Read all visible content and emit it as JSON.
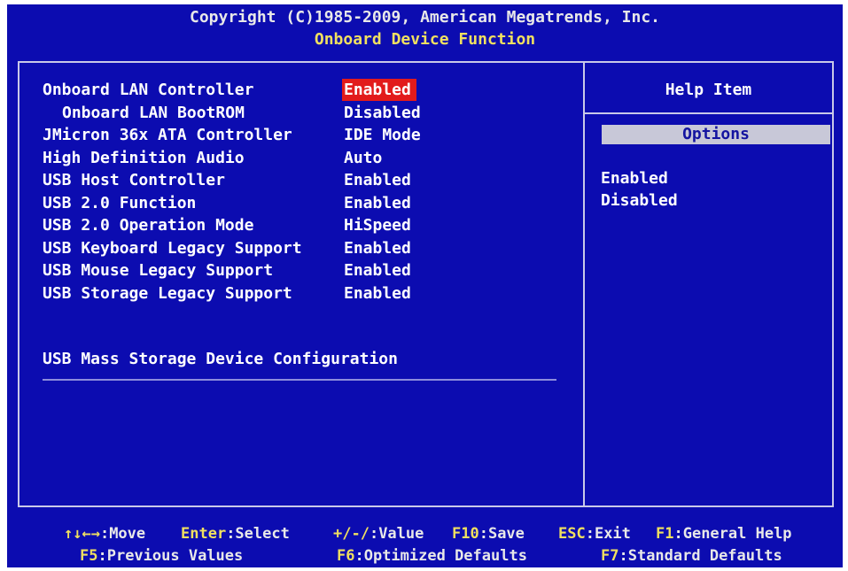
{
  "header": {
    "copyright": "Copyright (C)1985-2009, American Megatrends, Inc.",
    "page_title": "Onboard Device Function"
  },
  "settings": [
    {
      "label": "Onboard LAN Controller",
      "value": "Enabled",
      "indent": false,
      "selected": true
    },
    {
      "label": "Onboard LAN BootROM",
      "value": "Disabled",
      "indent": true,
      "selected": false
    },
    {
      "label": "JMicron 36x ATA Controller",
      "value": "IDE Mode",
      "indent": false,
      "selected": false
    },
    {
      "label": "High Definition Audio",
      "value": "Auto",
      "indent": false,
      "selected": false
    },
    {
      "label": "USB Host Controller",
      "value": "Enabled",
      "indent": false,
      "selected": false
    },
    {
      "label": "USB 2.0 Function",
      "value": "Enabled",
      "indent": false,
      "selected": false
    },
    {
      "label": "USB 2.0 Operation Mode",
      "value": "HiSpeed",
      "indent": false,
      "selected": false
    },
    {
      "label": "USB Keyboard Legacy Support",
      "value": "Enabled",
      "indent": false,
      "selected": false
    },
    {
      "label": "USB Mouse Legacy Support",
      "value": "Enabled",
      "indent": false,
      "selected": false
    },
    {
      "label": "USB Storage Legacy Support",
      "value": "Enabled",
      "indent": false,
      "selected": false
    }
  ],
  "submenu": {
    "label": "USB Mass Storage Device Configuration"
  },
  "help": {
    "title": "Help Item",
    "options_label": "Options",
    "options": [
      "Enabled",
      "Disabled"
    ]
  },
  "footer": {
    "row1": [
      {
        "key": "↑↓←→",
        "action": ":Move"
      },
      {
        "key": "Enter",
        "action": ":Select"
      },
      {
        "key": "+/-/",
        "action": ":Value"
      },
      {
        "key": "F10",
        "action": ":Save"
      },
      {
        "key": "ESC",
        "action": ":Exit"
      },
      {
        "key": "F1",
        "action": ":General Help"
      }
    ],
    "row2": [
      {
        "key": "F5",
        "action": ":Previous Values"
      },
      {
        "key": "F6",
        "action": ":Optimized Defaults"
      },
      {
        "key": "F7",
        "action": ":Standard Defaults"
      }
    ]
  },
  "colors": {
    "background": "#0c0cb0",
    "highlight": "#e21b1b",
    "options_bar": "#c8c8d8",
    "key_text": "#f0e060"
  }
}
